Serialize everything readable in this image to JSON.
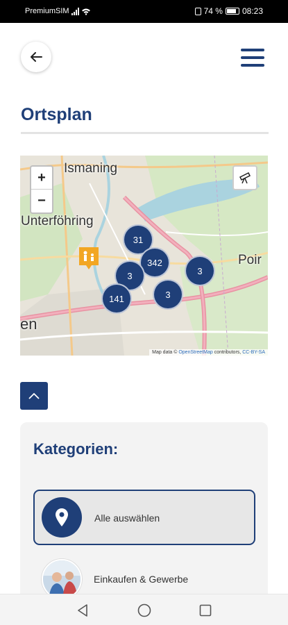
{
  "status_bar": {
    "carrier": "PremiumSIM",
    "battery": "74 %",
    "time": "08:23"
  },
  "header": {
    "back_icon": "arrow-left-icon",
    "menu_icon": "hamburger-menu-icon"
  },
  "page_title": "Ortsplan",
  "map": {
    "places": {
      "ismaning": "Ismaning",
      "unterfoehring": "Unterföhring",
      "poing": "Poir",
      "edge": "en"
    },
    "zoom_in": "+",
    "zoom_out": "−",
    "clusters": [
      "31",
      "342",
      "3",
      "3",
      "3",
      "141"
    ],
    "attribution": {
      "prefix": "Map data © ",
      "osm": "OpenStreetMap",
      "middle": " contributors, ",
      "license": "CC-BY-SA"
    },
    "colors": {
      "cluster": "#1f3f78",
      "poi": "#f2a623",
      "water": "#aad3df",
      "motorway": "#e892a2"
    }
  },
  "categories": {
    "heading": "Kategorien:",
    "items": [
      {
        "label": "Alle auswählen",
        "icon": "location-pin-icon",
        "selected": true
      },
      {
        "label": "Einkaufen & Gewerbe",
        "icon": "shopping-photo"
      }
    ]
  },
  "nav": {
    "back": "back-triangle-icon",
    "home": "home-circle-icon",
    "recents": "recents-square-icon"
  }
}
